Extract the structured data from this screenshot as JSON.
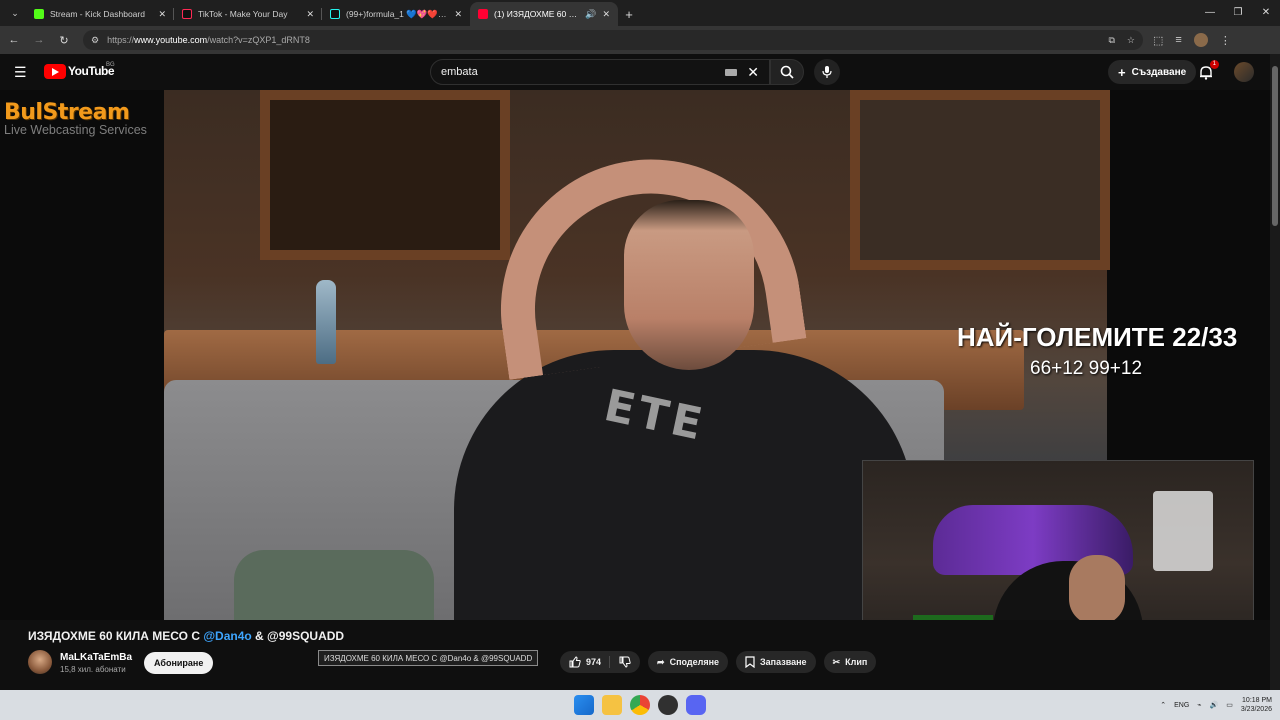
{
  "browser": {
    "tabs": [
      {
        "title": "Stream - Kick Dashboard",
        "favicon_color": "#53fc18",
        "active": false
      },
      {
        "title": "TikTok - Make Your Day",
        "favicon_color": "#111111",
        "active": false
      },
      {
        "title": "(99+)formula_1 💙💖❤️ (@re",
        "favicon_color": "#111111",
        "active": false
      },
      {
        "title": "(1) ИЗЯДОХМЕ 60 КИЛА М",
        "favicon_color": "#ff0033",
        "active": true
      }
    ],
    "url_prefix": "https://",
    "url_host": "www.youtube.com",
    "url_path": "/watch?v=zQXP1_dRNT8"
  },
  "youtube": {
    "logo_text": "YouTube",
    "region": "BG",
    "search_query": "embata",
    "create_label": "Създаване",
    "notification_count": "1"
  },
  "video": {
    "watermark_brand": "BulStream",
    "watermark_sub": "Live Webcasting Services",
    "overlay_title": "НАЙ-ГОЛЕМИТЕ 22/33",
    "overlay_sub": "66+12 99+12",
    "shirt_text": "ETE"
  },
  "info": {
    "title_before": "ИЗЯДОХМЕ 60 КИЛА МЕСО С ",
    "title_mention": "@Dan4o",
    "title_after": " & @99SQUADD",
    "channel_name": "MaLKaTaEmBa",
    "channel_subs": "15,8 хил. абонати",
    "subscribe_label": "Абониране",
    "tooltip": "ИЗЯДОХМЕ 60 КИЛА МЕСО С @Dan4o & @99SQUADD",
    "likes": "974",
    "share_label": "Споделяне",
    "save_label": "Запазване",
    "clip_label": "Клип"
  },
  "taskbar": {
    "lang": "ENG",
    "time": "10:18 PM",
    "date": "3/23/2026"
  }
}
